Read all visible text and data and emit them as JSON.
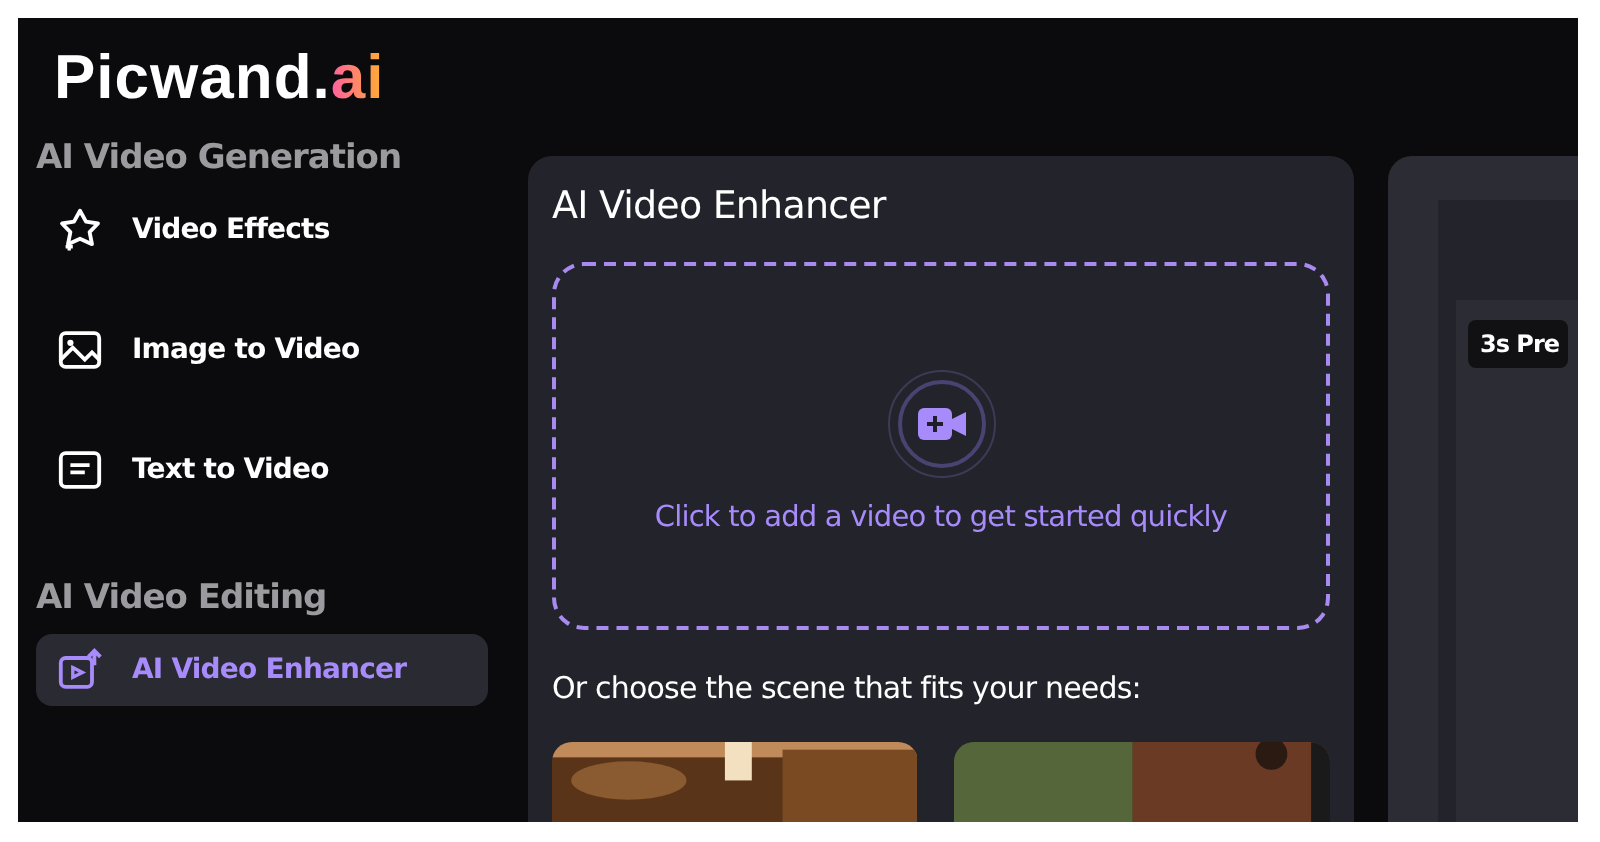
{
  "logo": {
    "name": "Picwand.",
    "suffix": "ai"
  },
  "sidebar": {
    "sections": [
      {
        "heading": "AI Video Generation",
        "items": [
          {
            "label": "Video Effects",
            "selected": false
          },
          {
            "label": "Image to Video",
            "selected": false
          },
          {
            "label": "Text to Video",
            "selected": false
          }
        ]
      },
      {
        "heading": "AI Video Editing",
        "items": [
          {
            "label": "AI Video Enhancer",
            "selected": true
          }
        ]
      }
    ]
  },
  "main": {
    "title": "AI Video Enhancer",
    "upload": {
      "label": "Click to add a video to get started quickly"
    },
    "scene_prompt": "Or choose the scene that fits your needs:"
  },
  "preview": {
    "badge": "3s Pre"
  }
}
